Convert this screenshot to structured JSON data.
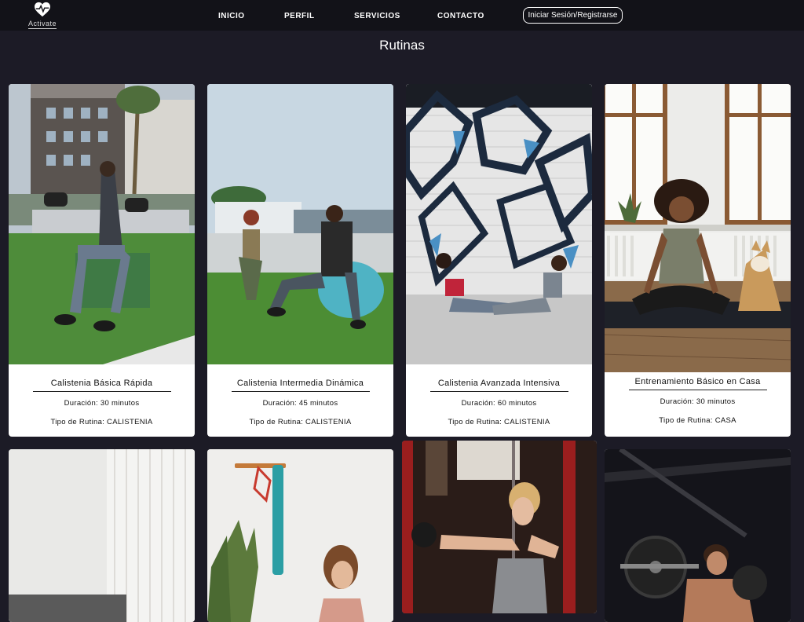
{
  "nav": {
    "brand": "Activate",
    "links": [
      "INICIO",
      "PERFIL",
      "SERVICIOS",
      "CONTACTO"
    ],
    "login_label": "Iniciar Sesión/Registrarse"
  },
  "page": {
    "title": "Rutinas"
  },
  "routines": [
    {
      "name": "Calistenia Básica Rápida",
      "duration": "Duración: 30 minutos",
      "type": "Tipo de Rutina: CALISTENIA",
      "image": "man-dumbbells-outdoor"
    },
    {
      "name": "Calistenia Intermedia Dinámica",
      "duration": "Duración: 45 minutos",
      "type": "Tipo de Rutina: CALISTENIA",
      "image": "couple-exercise-ball-park"
    },
    {
      "name": "Calistenia Avanzada Intensiva",
      "duration": "Duración: 60 minutos",
      "type": "Tipo de Rutina: CALISTENIA",
      "image": "couple-situps-graffiti-wall"
    },
    {
      "name": "Entrenamiento Básico en Casa",
      "duration": "Duración: 30 minutos",
      "type": "Tipo de Rutina: CASA",
      "image": "woman-meditating-with-dog"
    }
  ],
  "more_routines_images": [
    "white-room-curtain",
    "woman-resistance-band",
    "woman-kettlebell-gym",
    "man-barbell-dark-gym"
  ],
  "colors": {
    "background": "#1c1b26",
    "navbar": "#121218",
    "card": "#ffffff"
  }
}
